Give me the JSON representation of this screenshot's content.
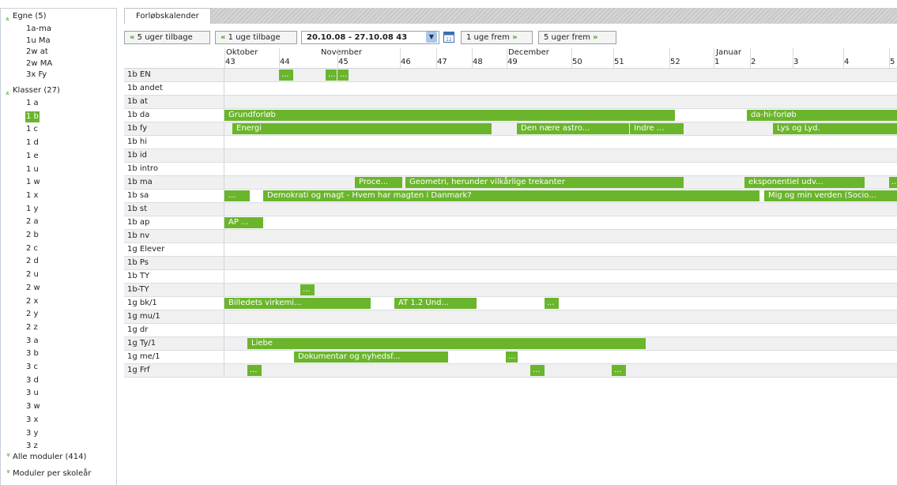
{
  "sidebar": {
    "egne": {
      "label": "Egne (5)",
      "items": [
        "1a-ma",
        "1u Ma",
        "2w at",
        "2w MA",
        "3x Fy"
      ]
    },
    "klasser": {
      "label": "Klasser (27)",
      "selected": "1 b",
      "items": [
        "1 a",
        "1 b",
        "1 c",
        "1 d",
        "1 e",
        "1 u",
        "1 w",
        "1 x",
        "1 y",
        "2 a",
        "2 b",
        "2 c",
        "2 d",
        "2 u",
        "2 w",
        "2 x",
        "2 y",
        "2 z",
        "3 a",
        "3 b",
        "3 c",
        "3 d",
        "3 u",
        "3 w",
        "3 x",
        "3 y",
        "3 z"
      ]
    },
    "alle_moduler": "Alle moduler (414)",
    "moduler_per_skolear": "Moduler per skoleår"
  },
  "tab": {
    "label": "Forløbskalender"
  },
  "toolbar": {
    "back5": "5 uger tilbage",
    "back1": "1 uge tilbage",
    "date_range": "20.10.08 - 27.10.08 43",
    "fwd1": "1 uge frem",
    "fwd5": "5 uger frem",
    "calendar_icon": "calendar-icon",
    "dropdown_icon": "chevron-down-icon"
  },
  "calendar": {
    "months": [
      "Oktober",
      "November",
      "December",
      "Januar"
    ],
    "weeks": [
      "43",
      "44",
      "45",
      "46",
      "47",
      "48",
      "49",
      "50",
      "51",
      "52",
      "1",
      "2",
      "3",
      "4",
      "5"
    ],
    "rows": [
      {
        "label": "1b EN",
        "bars": [
          {
            "text": "...",
            "w": 0
          },
          {
            "text": "...",
            "w": 1
          },
          {
            "text": "...",
            "w": 2
          }
        ]
      },
      {
        "label": "1b andet",
        "bars": []
      },
      {
        "label": "1b at",
        "bars": []
      },
      {
        "label": "1b da",
        "bars": [
          {
            "text": "Grundforløb",
            "w": 3
          },
          {
            "text": "da-hi-forløb",
            "w": 4
          }
        ]
      },
      {
        "label": "1b fy",
        "bars": [
          {
            "text": "Energi",
            "w": 5
          },
          {
            "text": "Den nære astro...",
            "w": 6
          },
          {
            "text": "Indre ...",
            "w": 7
          },
          {
            "text": "Lys og Lyd.",
            "w": 8
          }
        ]
      },
      {
        "label": "1b hi",
        "bars": []
      },
      {
        "label": "1b id",
        "bars": []
      },
      {
        "label": "1b intro",
        "bars": []
      },
      {
        "label": "1b ma",
        "bars": [
          {
            "text": "Proce...",
            "w": 9
          },
          {
            "text": "Geometri, herunder vilkårlige trekanter",
            "w": 10
          },
          {
            "text": "eksponentiel udv...",
            "w": 11
          },
          {
            "text": "...",
            "w": 12
          }
        ]
      },
      {
        "label": "1b sa",
        "bars": [
          {
            "text": "...",
            "w": 13
          },
          {
            "text": "Demokrati og magt - Hvem har magten i Danmark?",
            "w": 14
          },
          {
            "text": "Mig og min verden (Socio...",
            "w": 15
          }
        ]
      },
      {
        "label": "1b st",
        "bars": []
      },
      {
        "label": "1b ap",
        "bars": [
          {
            "text": "AP ...",
            "w": 16
          }
        ]
      },
      {
        "label": "1b nv",
        "bars": []
      },
      {
        "label": "1g Elever",
        "bars": []
      },
      {
        "label": "1b Ps",
        "bars": []
      },
      {
        "label": "1b TY",
        "bars": []
      },
      {
        "label": "1b-TY",
        "bars": [
          {
            "text": "...",
            "w": 17
          }
        ]
      },
      {
        "label": "1g bk/1",
        "bars": [
          {
            "text": "Billedets virkemi...",
            "w": 18
          },
          {
            "text": "AT 1.2 Und...",
            "w": 19
          },
          {
            "text": "...",
            "w": 20
          }
        ]
      },
      {
        "label": "1g mu/1",
        "bars": []
      },
      {
        "label": "1g dr",
        "bars": []
      },
      {
        "label": "1g Ty/1",
        "bars": [
          {
            "text": "Liebe",
            "w": 21
          }
        ]
      },
      {
        "label": "1g me/1",
        "bars": [
          {
            "text": "Dokumentar og nyhedsf...",
            "w": 22
          },
          {
            "text": "...",
            "w": 23
          }
        ]
      },
      {
        "label": "1g Frf",
        "bars": [
          {
            "text": "...",
            "w": 24
          },
          {
            "text": "...",
            "w": 25
          },
          {
            "text": "...",
            "w": 26
          }
        ]
      }
    ]
  }
}
